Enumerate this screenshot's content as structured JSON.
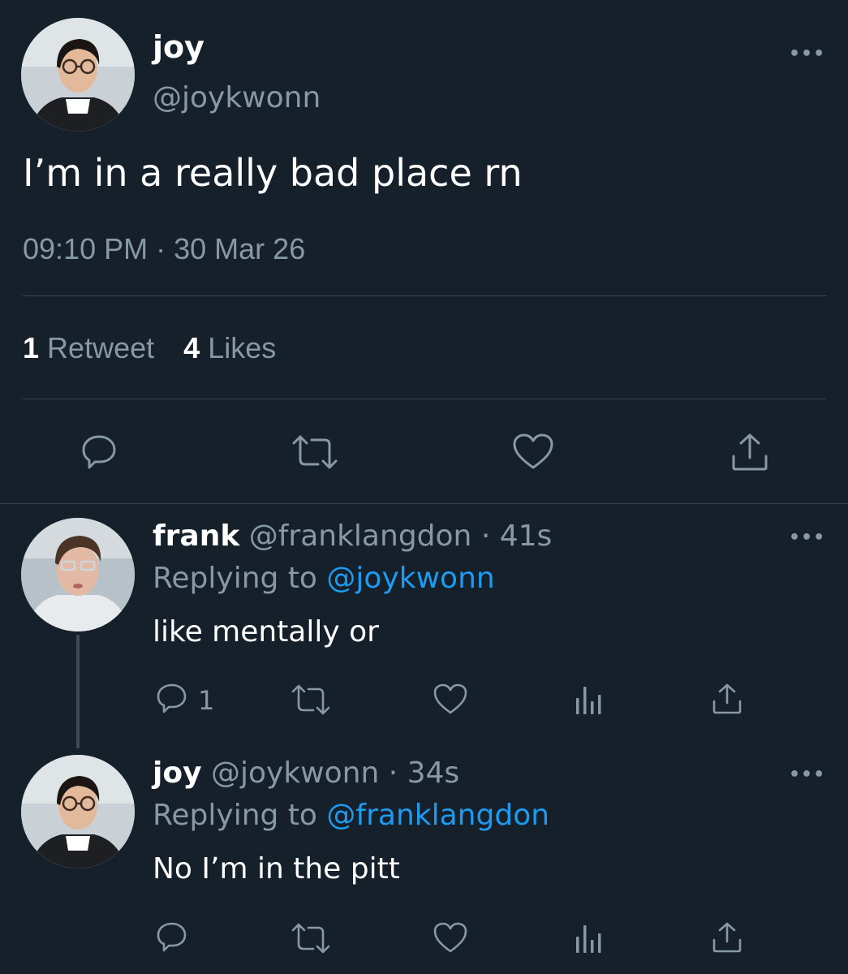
{
  "main_tweet": {
    "display_name": "joy",
    "handle": "@joykwonn",
    "more": "•••",
    "text": "I’m in a really bad place rn",
    "time": "09:10 PM",
    "separator": "·",
    "date": "30 Mar 26",
    "retweet_count": "1",
    "retweet_label": "Retweet",
    "like_count": "4",
    "like_label": "Likes",
    "actions": [
      "reply-icon",
      "retweet-icon",
      "heart-icon",
      "share-icon"
    ]
  },
  "replies": [
    {
      "display_name": "frank",
      "handle": "@franklangdon",
      "time_ago": "· 41s",
      "replying_to_label": "Replying to",
      "replying_to_handle": "@joykwonn",
      "text": "like mentally or",
      "reply_count": "1",
      "more": "•••",
      "actions": [
        "reply-icon",
        "retweet-icon",
        "heart-icon",
        "analytics-icon",
        "share-icon"
      ]
    },
    {
      "display_name": "joy",
      "handle": "@joykwonn",
      "time_ago": "· 34s",
      "replying_to_label": "Replying to",
      "replying_to_handle": "@franklangdon",
      "text": "No I’m in the pitt",
      "reply_count": "",
      "more": "•••",
      "actions": [
        "reply-icon",
        "retweet-icon",
        "heart-icon",
        "analytics-icon",
        "share-icon"
      ]
    }
  ],
  "colors": {
    "background": "#15202b",
    "text": "#ffffff",
    "muted": "#8899a6",
    "link": "#1d9bf0",
    "divider": "#38444d"
  }
}
